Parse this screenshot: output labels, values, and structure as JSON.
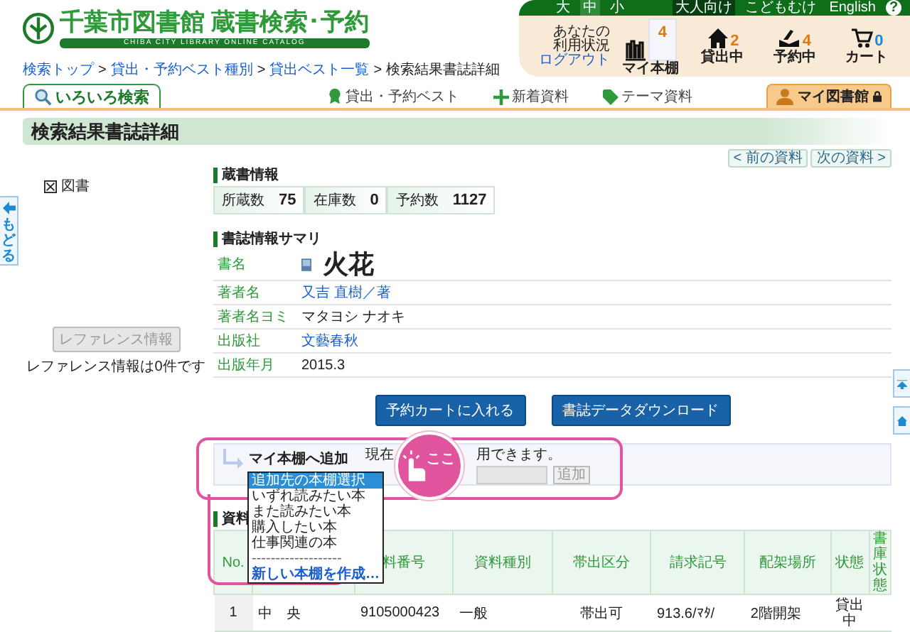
{
  "header": {
    "logo_title": "千葉市図書館 蔵書検索･予約",
    "logo_subtitle": "CHIBA CITY LIBRARY ONLINE CATALOG",
    "font_sizes": [
      {
        "label": "大",
        "selected": false
      },
      {
        "label": "中",
        "selected": true
      },
      {
        "label": "小",
        "selected": false
      }
    ],
    "audience": [
      {
        "label": "大人向け",
        "selected": true
      },
      {
        "label": "こどもむけ",
        "selected": false
      },
      {
        "label": "English",
        "selected": false
      }
    ],
    "help": "?",
    "status_label": "あなたの利用状況",
    "logout": "ログアウト",
    "counters": [
      {
        "kind": "shelf",
        "label": "マイ本棚",
        "count": "4"
      },
      {
        "kind": "loan",
        "label": "貸出中",
        "count": "2"
      },
      {
        "kind": "reserve",
        "label": "予約中",
        "count": "4"
      },
      {
        "kind": "cart",
        "label": "カート",
        "count": "0"
      }
    ]
  },
  "breadcrumb": [
    {
      "label": "検索トップ",
      "link": true
    },
    {
      "separator": ">",
      "label": "貸出・予約ベスト種別",
      "link": true
    },
    {
      "separator": ">",
      "label": "貸出ベスト一覧",
      "link": true
    },
    {
      "separator": ">",
      "label": "検索結果書誌詳細",
      "link": false
    }
  ],
  "nav": {
    "tabs": [
      {
        "kind": "search",
        "label": "いろいろ検索",
        "selected": true
      },
      {
        "kind": "best",
        "label": "貸出・予約ベスト",
        "selected": false
      },
      {
        "kind": "new",
        "label": "新着資料",
        "selected": false
      },
      {
        "kind": "theme",
        "label": "テーマ資料",
        "selected": false
      }
    ],
    "my_library": "マイ図書館"
  },
  "page_title": "検索結果書誌詳細",
  "pager": [
    "< 前の資料",
    "次の資料 >"
  ],
  "sidebar": {
    "back": "もどる",
    "material_type": "図書",
    "reference_button": "レファレンス情報",
    "reference_note": "レファレンス情報は0件です"
  },
  "holdings": {
    "heading": "蔵書情報",
    "stats": [
      {
        "label": "所蔵数",
        "value": "75"
      },
      {
        "label": "在庫数",
        "value": "0"
      },
      {
        "label": "予約数",
        "value": "1127"
      }
    ]
  },
  "summary": {
    "heading": "書誌情報サマリ",
    "rows": [
      {
        "kind": "title",
        "label": "書名",
        "value": "火花"
      },
      {
        "kind": "link",
        "label": "著者名",
        "value": "又吉 直樹／著"
      },
      {
        "kind": "text",
        "label": "著者名ヨミ",
        "value": "マタヨシ ナオキ"
      },
      {
        "kind": "link",
        "label": "出版社",
        "value": "文藝春秋"
      },
      {
        "kind": "text",
        "label": "出版年月",
        "value": "2015.3"
      }
    ]
  },
  "actions": [
    "予約カートに入れる",
    "書誌データダウンロード"
  ],
  "my_shelf": {
    "title": "マイ本棚へ追加",
    "note_start": "現在",
    "note_end": "用できます。",
    "add_button": "追加",
    "callout": "ここ",
    "options": [
      {
        "kind": "option",
        "label": "追加先の本棚選択",
        "selected": true
      },
      {
        "kind": "option",
        "label": "いずれ読みたい本",
        "selected": false
      },
      {
        "kind": "option",
        "label": "また読みたい本",
        "selected": false
      },
      {
        "kind": "option",
        "label": "購入したい本",
        "selected": false
      },
      {
        "kind": "option",
        "label": "仕事関連の本",
        "selected": false
      },
      {
        "kind": "separator",
        "label": "-------------------",
        "selected": false
      },
      {
        "kind": "create",
        "label": "新しい本棚を作成…",
        "selected": false
      }
    ]
  },
  "materials": {
    "heading": "資料",
    "columns": [
      "No.",
      "",
      "料番号",
      "資料種別",
      "帯出区分",
      "請求記号",
      "配架場所",
      "状態",
      "書庫状態"
    ],
    "rows": [
      {
        "cells": [
          "1",
          "中　央",
          "9105000423",
          "一般",
          "帯出可",
          "913.6/ﾏﾀ/",
          "2階開架",
          "貸出中"
        ]
      }
    ]
  }
}
